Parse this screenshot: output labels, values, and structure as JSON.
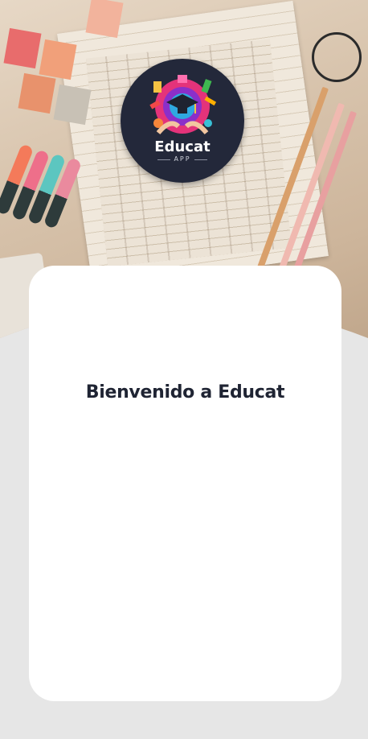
{
  "header": {
    "logo": {
      "title": "Educat",
      "subtitle": "APP",
      "icon": "graduation-cap-icon",
      "colors": {
        "badge": "#23283a",
        "accent_pink": "#e4337a",
        "accent_blue": "#2fa9e0"
      }
    }
  },
  "card": {
    "title": "Bienvenido a Educat"
  },
  "colors": {
    "background": "#e6e6e6",
    "card": "#ffffff",
    "title": "#1f2433"
  }
}
